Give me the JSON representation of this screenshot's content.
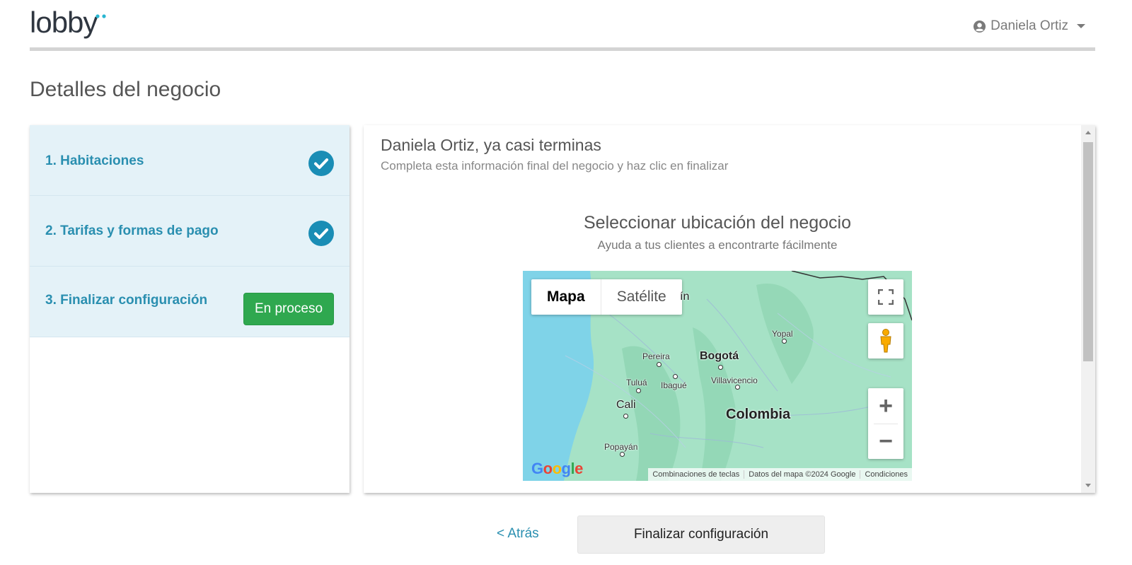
{
  "header": {
    "logo_text": "lobby",
    "user_name": "Daniela Ortiz"
  },
  "page_title": "Detalles del negocio",
  "steps": [
    {
      "label": "1. Habitaciones",
      "status": "done"
    },
    {
      "label": "2. Tarifas y formas de pago",
      "status": "done"
    },
    {
      "label": "3. Finalizar configuración",
      "status": "in-progress",
      "badge": "En proceso"
    }
  ],
  "content": {
    "title": "Daniela Ortiz, ya casi terminas",
    "subtitle": "Completa esta información final del negocio y haz clic en finalizar",
    "location_title": "Seleccionar ubicación del negocio",
    "location_subtitle": "Ayuda a tus clientes a encontrarte fácilmente"
  },
  "map": {
    "type_buttons": [
      "Mapa",
      "Satélite"
    ],
    "active_type": "Mapa",
    "cities": [
      {
        "name": "Pereira"
      },
      {
        "name": "Bogotá"
      },
      {
        "name": "Yopal"
      },
      {
        "name": "Tuluá"
      },
      {
        "name": "Ibagué"
      },
      {
        "name": "Villavicencio"
      },
      {
        "name": "Cali"
      },
      {
        "name": "Popayán"
      },
      {
        "name": "ín"
      }
    ],
    "country_label": "Colombia",
    "zoom_in": "+",
    "zoom_out": "−",
    "google_logo": "Google",
    "attribution": [
      "Combinaciones de teclas",
      "Datos del mapa ©2024 Google",
      "Condiciones"
    ]
  },
  "buttons": {
    "back": "< Atrás",
    "finish": "Finalizar configuración"
  },
  "colors": {
    "accent": "#1a8db5",
    "success": "#2fa84f",
    "step_bg": "#e4f2f8"
  }
}
